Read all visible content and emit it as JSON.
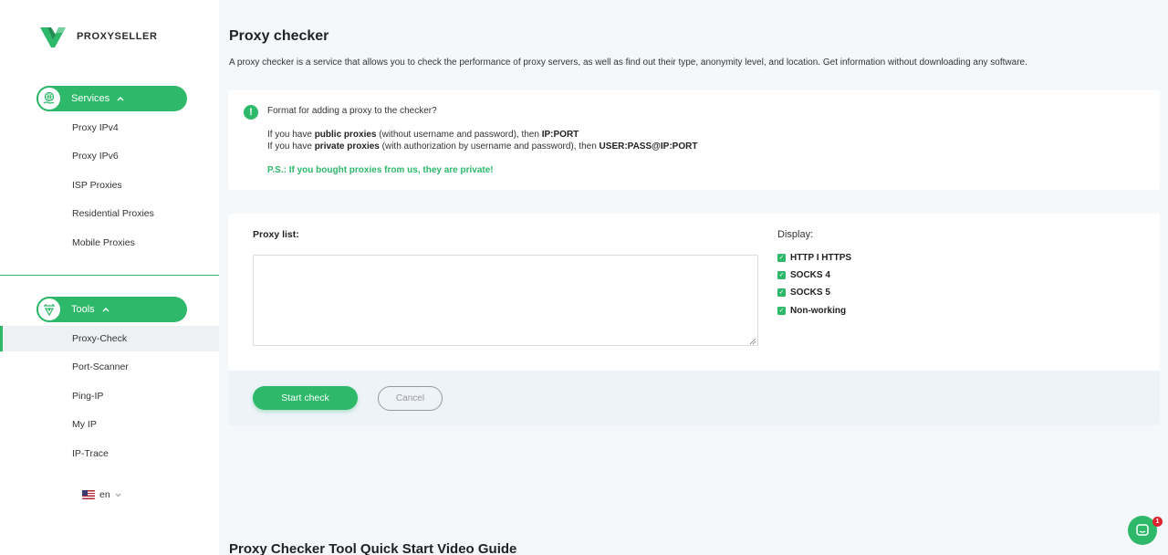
{
  "brand": {
    "name": "PROXYSELLER",
    "color": "#2db86a"
  },
  "sidebar": {
    "services": {
      "label": "Services",
      "icon": "globe-hand-icon",
      "items": [
        {
          "label": "Proxy IPv4"
        },
        {
          "label": "Proxy IPv6"
        },
        {
          "label": "ISP Proxies"
        },
        {
          "label": "Residential Proxies"
        },
        {
          "label": "Mobile Proxies"
        }
      ]
    },
    "tools": {
      "label": "Tools",
      "icon": "tools-icon",
      "items": [
        {
          "label": "Proxy-Check",
          "active": true
        },
        {
          "label": "Port-Scanner"
        },
        {
          "label": "Ping-IP"
        },
        {
          "label": "My IP"
        },
        {
          "label": "IP-Trace"
        }
      ]
    },
    "language": {
      "label": "en",
      "flag": "us-flag-icon"
    }
  },
  "main": {
    "title": "Proxy checker",
    "description": "A proxy checker is a service that allows you to check the performance of proxy servers, as well as find out their type, anonymity level, and location. Get information without downloading any software.",
    "info": {
      "question": "Format for adding a proxy to the checker?",
      "line1": {
        "prefix": "If you have ",
        "bold": "public proxies",
        "middle": " (without username and password), then ",
        "format": "IP:PORT"
      },
      "line2": {
        "prefix": "If you have ",
        "bold": "private proxies",
        "middle": " (with authorization by username and password), then ",
        "format": "USER:PASS@IP:PORT"
      },
      "ps": "P.S.: If you bought proxies from us, they are private!"
    },
    "checker": {
      "proxy_list_label": "Proxy list:",
      "proxy_list_value": "",
      "display_label": "Display:",
      "options": [
        {
          "label": "HTTP I HTTPS",
          "checked": true
        },
        {
          "label": "SOCKS 4",
          "checked": true
        },
        {
          "label": "SOCKS 5",
          "checked": true
        },
        {
          "label": "Non-working",
          "checked": true
        }
      ],
      "start_label": "Start check",
      "cancel_label": "Cancel"
    },
    "video_title": "Proxy Checker Tool Quick Start Video Guide"
  },
  "chat": {
    "badge": "1",
    "icon": "chat-icon"
  }
}
